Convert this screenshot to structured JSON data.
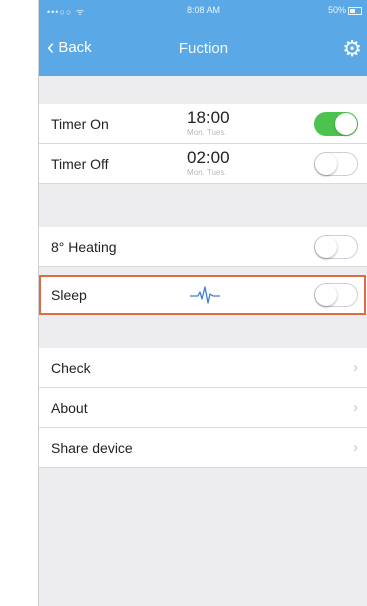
{
  "status_bar": {
    "carrier": "•••○○ ᯤ",
    "time": "8:08 AM",
    "battery": "50%"
  },
  "nav": {
    "back_label": "Back",
    "title": "Fuction"
  },
  "timers": [
    {
      "label": "Timer On",
      "time": "18:00",
      "days": "Mon. Tues.",
      "on": true
    },
    {
      "label": "Timer Off",
      "time": "02:00",
      "days": "Mon. Tues.",
      "on": false
    }
  ],
  "features": [
    {
      "label": "8° Heating",
      "on": false
    },
    {
      "label": "Sleep",
      "on": false
    }
  ],
  "menu": [
    {
      "label": "Check"
    },
    {
      "label": "About"
    },
    {
      "label": "Share device"
    }
  ],
  "colors": {
    "header": "#5aa9e6",
    "toggle_on": "#4cc24f",
    "highlight": "#e06a43",
    "background": "#ededef"
  },
  "icons": {
    "back": "chevron-left-icon",
    "settings": "gear-icon",
    "sleep": "sleep-wave-icon",
    "menu_arrow": "chevron-right-icon"
  }
}
